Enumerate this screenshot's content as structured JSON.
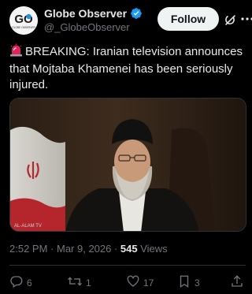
{
  "author": {
    "display_name": "Globe Observer",
    "handle": "@_GlobeObserver",
    "avatar_text": "GO",
    "avatar_subtext": "GLOBE OBSERVER",
    "verified": true
  },
  "follow_label": "Follow",
  "tweet": {
    "text": "BREAKING: Iranian television announces that Mojtaba Khamenei has been seriously injured."
  },
  "media": {
    "watermark": "AL-ALAM TV"
  },
  "meta": {
    "time": "2:52 PM",
    "separator": " · ",
    "date": "Mar 9, 2026",
    "separator2": " · ",
    "views_count": "545",
    "views_label": " Views"
  },
  "actions": {
    "replies": "6",
    "reposts": "1",
    "likes": "17",
    "bookmarks": "3"
  },
  "colors": {
    "background": "#000000",
    "text": "#e7e9ea",
    "muted": "#71767b",
    "verified": "#1d9bf0",
    "follow_bg": "#eff3f4"
  },
  "icons": [
    "verified-badge-icon",
    "grok-icon",
    "more-icon",
    "siren-icon",
    "reply-icon",
    "repost-icon",
    "like-icon",
    "bookmark-icon",
    "share-icon"
  ]
}
